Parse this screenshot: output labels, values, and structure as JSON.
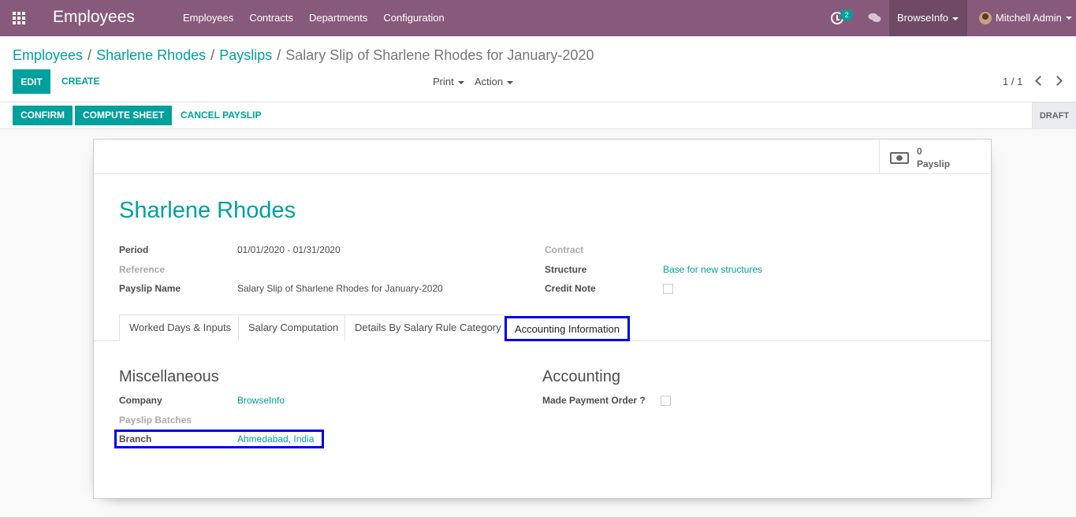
{
  "navbar": {
    "app_title": "Employees",
    "menu": [
      "Employees",
      "Contracts",
      "Departments",
      "Configuration"
    ],
    "activity_count": "2",
    "company": "BrowseInfo",
    "user": "Mitchell Admin"
  },
  "control_panel": {
    "breadcrumb": [
      "Employees",
      "Sharlene Rhodes",
      "Payslips"
    ],
    "breadcrumb_active": "Salary Slip of Sharlene Rhodes for January-2020",
    "edit_label": "EDIT",
    "create_label": "CREATE",
    "print_label": "Print",
    "action_label": "Action",
    "pager": "1 / 1"
  },
  "statusbar": {
    "confirm_label": "CONFIRM",
    "compute_label": "COMPUTE SHEET",
    "cancel_label": "CANCEL PAYSLIP",
    "state": "DRAFT"
  },
  "sheet": {
    "stat_button": {
      "value": "0",
      "label": "Payslip"
    },
    "employee_name": "Sharlene Rhodes",
    "left_fields": {
      "period_label": "Period",
      "period_value": "01/01/2020 - 01/31/2020",
      "reference_label": "Reference",
      "payslip_name_label": "Payslip Name",
      "payslip_name_value": "Salary Slip of Sharlene Rhodes for January-2020"
    },
    "right_fields": {
      "contract_label": "Contract",
      "structure_label": "Structure",
      "structure_value": "Base for new structures",
      "credit_note_label": "Credit Note"
    },
    "tabs": [
      "Worked Days & Inputs",
      "Salary Computation",
      "Details By Salary Rule Category",
      "Accounting Information"
    ],
    "misc": {
      "title": "Miscellaneous",
      "company_label": "Company",
      "company_value": "BrowseInfo",
      "batches_label": "Payslip Batches",
      "branch_label": "Branch",
      "branch_value": "Ahmedabad, India"
    },
    "accounting": {
      "title": "Accounting",
      "payment_order_label": "Made Payment Order ?"
    }
  },
  "colors": {
    "navbar": "#875a7b",
    "accent": "#00a09d",
    "highlight": "#0000e0"
  }
}
